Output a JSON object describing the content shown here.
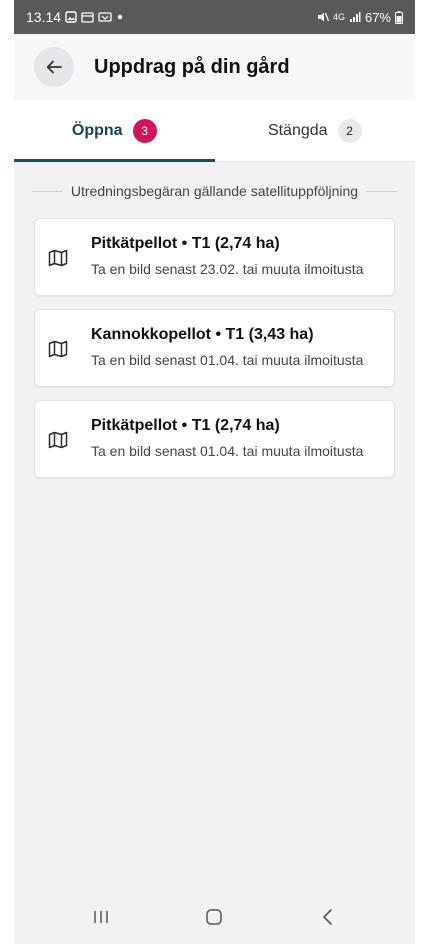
{
  "status_bar": {
    "time": "13.14",
    "battery": "67%",
    "network": "4G"
  },
  "header": {
    "title": "Uppdrag på din gård",
    "back_icon": "arrow-left-icon"
  },
  "tabs": [
    {
      "label": "Öppna",
      "count": "3",
      "active": true
    },
    {
      "label": "Stängda",
      "count": "2",
      "active": false
    }
  ],
  "section": {
    "label": "Utredningsbegäran gällande satellituppföljning"
  },
  "tasks": [
    {
      "title": "Pitkätpellot • T1 (2,74 ha)",
      "subtitle": "Ta en bild senast 23.02. tai muuta ilmoitusta",
      "icon": "map-icon"
    },
    {
      "title": "Kannokkopellot • T1 (3,43 ha)",
      "subtitle": "Ta en bild senast 01.04. tai muuta ilmoitusta",
      "icon": "map-icon"
    },
    {
      "title": "Pitkätpellot • T1 (2,74 ha)",
      "subtitle": "Ta en bild senast 01.04. tai muuta ilmoitusta",
      "icon": "map-icon"
    }
  ],
  "colors": {
    "accent": "#1f4a66",
    "badge_active": "#d0155c",
    "badge_inactive": "#e9e9ec",
    "status_bar": "#595959"
  }
}
